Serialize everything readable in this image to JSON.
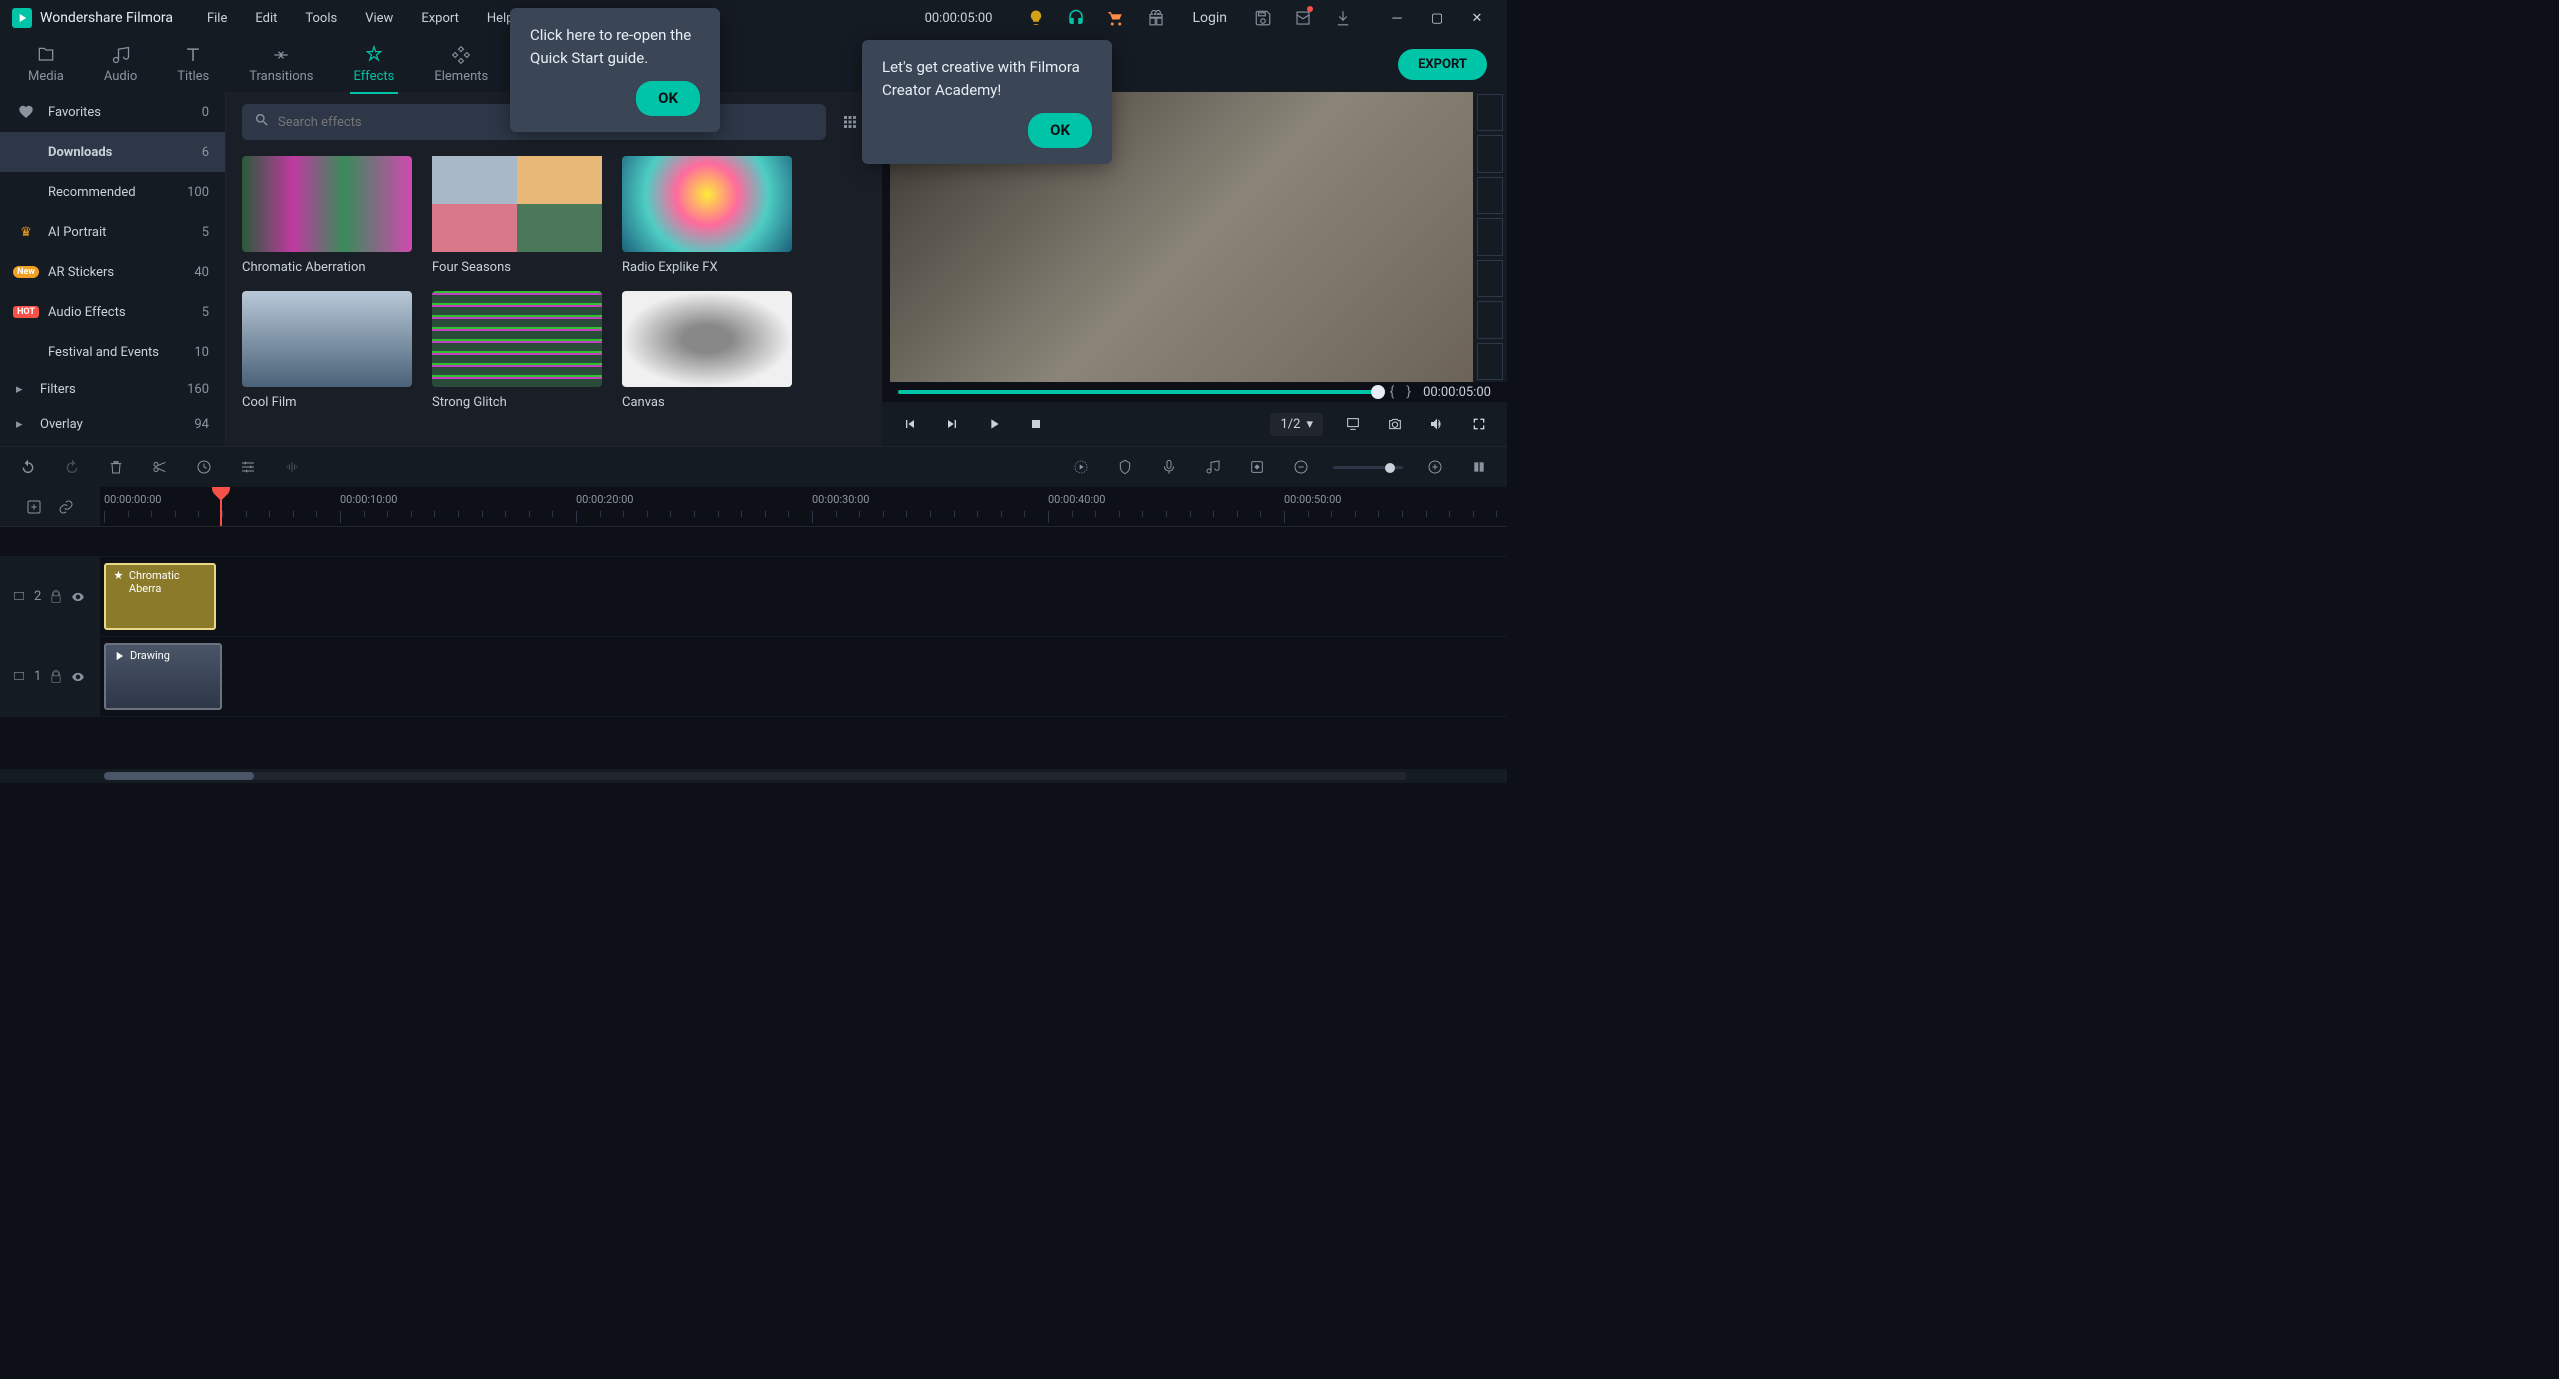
{
  "app": {
    "title": "Wondershare Filmora"
  },
  "menubar": [
    "File",
    "Edit",
    "Tools",
    "View",
    "Export",
    "Help"
  ],
  "titlebar_time": "00:00:05:00",
  "login_label": "Login",
  "tabs": [
    {
      "id": "media",
      "label": "Media"
    },
    {
      "id": "audio",
      "label": "Audio"
    },
    {
      "id": "titles",
      "label": "Titles"
    },
    {
      "id": "transitions",
      "label": "Transitions"
    },
    {
      "id": "effects",
      "label": "Effects"
    },
    {
      "id": "elements",
      "label": "Elements"
    }
  ],
  "active_tab": "effects",
  "export_label": "EXPORT",
  "sidebar": [
    {
      "icon": "heart",
      "label": "Favorites",
      "count": 0
    },
    {
      "icon": "",
      "label": "Downloads",
      "count": 6,
      "active": true
    },
    {
      "icon": "",
      "label": "Recommended",
      "count": 100
    },
    {
      "icon": "crown",
      "label": "AI Portrait",
      "count": 5
    },
    {
      "icon": "new",
      "label": "AR Stickers",
      "count": 40
    },
    {
      "icon": "hot",
      "label": "Audio Effects",
      "count": 5
    },
    {
      "icon": "",
      "label": "Festival and Events",
      "count": 10
    },
    {
      "icon": "chev",
      "label": "Filters",
      "count": 160
    },
    {
      "icon": "chev",
      "label": "Overlay",
      "count": 94
    }
  ],
  "search_placeholder": "Search effects",
  "effects": [
    {
      "label": "Chromatic Aberration",
      "cls": "th-chromatic"
    },
    {
      "label": "Four Seasons",
      "cls": "th-four"
    },
    {
      "label": "Radio Explike FX",
      "cls": "th-radio"
    },
    {
      "label": "Cool Film",
      "cls": "th-cool"
    },
    {
      "label": "Strong Glitch",
      "cls": "th-glitch"
    },
    {
      "label": "Canvas",
      "cls": "th-canvas"
    }
  ],
  "preview": {
    "time": "00:00:05:00",
    "zoom": "1/2"
  },
  "timeline": {
    "ticks": [
      "00:00:00:00",
      "00:00:10:00",
      "00:00:20:00",
      "00:00:30:00",
      "00:00:40:00",
      "00:00:50:00"
    ],
    "fx_clip": "Chromatic Aberra",
    "vid_clip": "Drawing",
    "track1_label": "2",
    "track2_label": "1"
  },
  "tooltip1": {
    "text": "Click here to re-open the Quick Start guide.",
    "ok": "OK"
  },
  "tooltip2": {
    "text": "Let's get creative with Filmora Creator Academy!",
    "ok": "OK"
  }
}
